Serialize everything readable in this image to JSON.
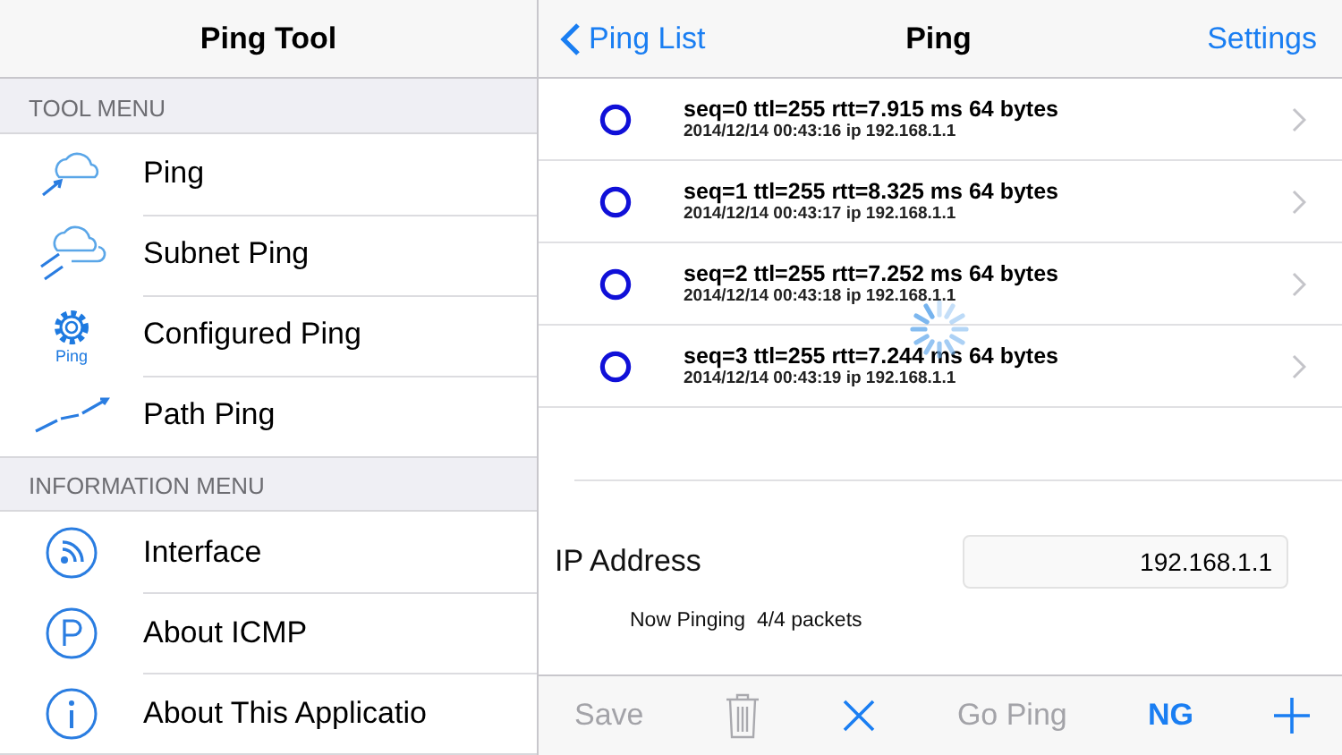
{
  "sidebar": {
    "title": "Ping Tool",
    "sections": [
      {
        "header": "TOOL MENU",
        "items": [
          {
            "label": "Ping",
            "kind": "cloud"
          },
          {
            "label": "Subnet Ping",
            "kind": "clouds"
          },
          {
            "label": "Configured Ping",
            "kind": "gear",
            "icon_caption": "Ping"
          },
          {
            "label": "Path Ping",
            "kind": "path"
          }
        ]
      },
      {
        "header": "INFORMATION MENU",
        "items": [
          {
            "label": "Interface",
            "kind": "signal"
          },
          {
            "label": "About ICMP",
            "kind": "p"
          },
          {
            "label": "About This Applicatio",
            "kind": "info"
          }
        ]
      }
    ]
  },
  "navbar": {
    "back": "Ping List",
    "title": "Ping",
    "action": "Settings"
  },
  "results": [
    {
      "summary": "seq=0 ttl=255 rtt=7.915 ms 64 bytes",
      "detail": "2014/12/14 00:43:16 ip 192.168.1.1"
    },
    {
      "summary": "seq=1 ttl=255 rtt=8.325 ms 64 bytes",
      "detail": "2014/12/14 00:43:17 ip 192.168.1.1"
    },
    {
      "summary": "seq=2 ttl=255 rtt=7.252 ms 64 bytes",
      "detail": "2014/12/14 00:43:18 ip 192.168.1.1"
    },
    {
      "summary": "seq=3 ttl=255 rtt=7.244 ms 64 bytes",
      "detail": "2014/12/14 00:43:19 ip 192.168.1.1"
    }
  ],
  "loading": true,
  "ip_field": {
    "label": "IP Address",
    "value": "192.168.1.1"
  },
  "status": "Now Pinging  4/4 packets",
  "toolbar": [
    {
      "kind": "text",
      "label": "Save",
      "disabled": true
    },
    {
      "kind": "trash",
      "disabled": true
    },
    {
      "kind": "close",
      "disabled": false
    },
    {
      "kind": "text",
      "label": "Go Ping",
      "disabled": true
    },
    {
      "kind": "bold",
      "label": "NG",
      "disabled": false
    },
    {
      "kind": "add",
      "disabled": false
    }
  ]
}
